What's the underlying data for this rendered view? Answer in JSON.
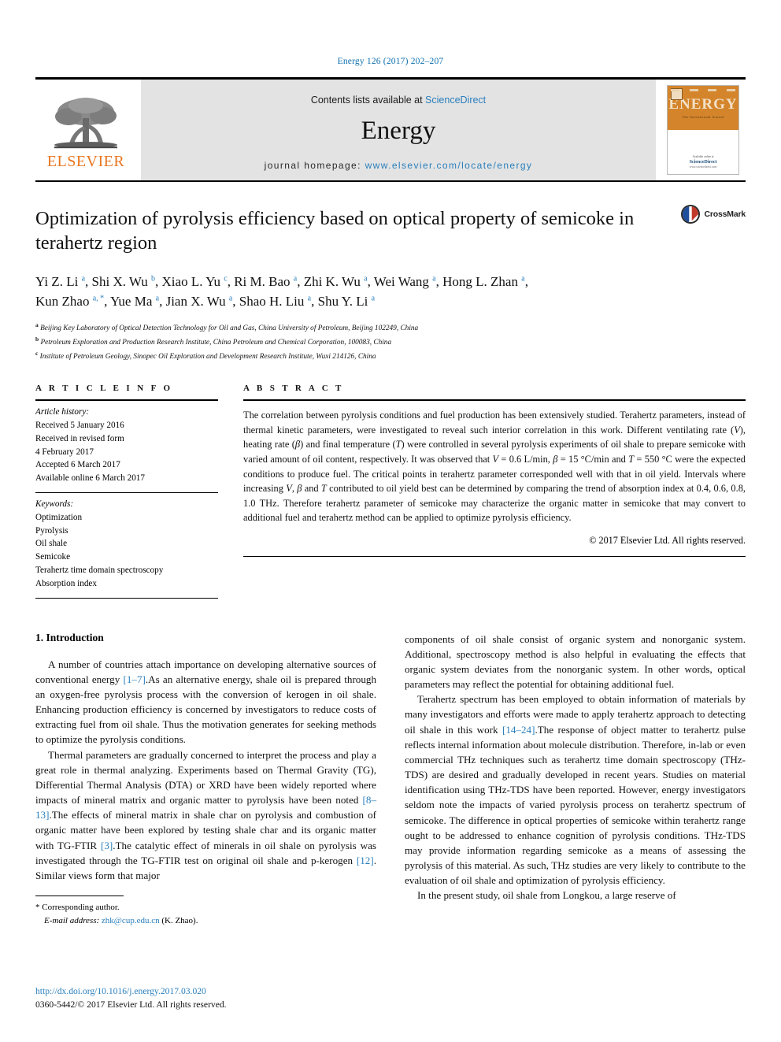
{
  "running_head": "Energy 126 (2017) 202–207",
  "masthead": {
    "publisher_name": "ELSEVIER",
    "contents_prefix": "Contents lists available at ",
    "contents_link": "ScienceDirect",
    "journal_title": "Energy",
    "homepage_prefix": "journal homepage: ",
    "homepage_url": "www.elsevier.com/locate/energy",
    "cover": {
      "title": "ENERGY",
      "subtitle": "The International Journal",
      "available_at": "Available online at",
      "sciencedirect": "ScienceDirect",
      "sd_url": "www.sciencedirect.com"
    }
  },
  "article": {
    "title": "Optimization of pyrolysis efficiency based on optical property of semicoke in terahertz region",
    "crossmark_label": "CrossMark",
    "authors_line_1": "Yi Z. Li ᵃ, Shi X. Wu ᵇ, Xiao L. Yu ᶜ, Ri M. Bao ᵃ, Zhi K. Wu ᵃ, Wei Wang ᵃ, Hong L. Zhan ᵃ,",
    "authors_line_2": "Kun Zhao ᵃ·*, Yue Ma ᵃ, Jian X. Wu ᵃ, Shao H. Liu ᵃ, Shu Y. Li ᵃ",
    "authors": [
      {
        "name": "Yi Z. Li",
        "sup": "a"
      },
      {
        "name": "Shi X. Wu",
        "sup": "b"
      },
      {
        "name": "Xiao L. Yu",
        "sup": "c"
      },
      {
        "name": "Ri M. Bao",
        "sup": "a"
      },
      {
        "name": "Zhi K. Wu",
        "sup": "a"
      },
      {
        "name": "Wei Wang",
        "sup": "a"
      },
      {
        "name": "Hong L. Zhan",
        "sup": "a"
      },
      {
        "name": "Kun Zhao",
        "sup": "a, *"
      },
      {
        "name": "Yue Ma",
        "sup": "a"
      },
      {
        "name": "Jian X. Wu",
        "sup": "a"
      },
      {
        "name": "Shao H. Liu",
        "sup": "a"
      },
      {
        "name": "Shu Y. Li",
        "sup": "a"
      }
    ],
    "affiliations": [
      {
        "mark": "a",
        "text": "Beijing Key Laboratory of Optical Detection Technology for Oil and Gas, China University of Petroleum, Beijing 102249, China"
      },
      {
        "mark": "b",
        "text": "Petroleum Exploration and Production Research Institute, China Petroleum and Chemical Corporation, 100083, China"
      },
      {
        "mark": "c",
        "text": "Institute of Petroleum Geology, Sinopec Oil Exploration and Development Research Institute, Wuxi 214126, China"
      }
    ]
  },
  "article_info": {
    "label": "A R T I C L E   I N F O",
    "history_label": "Article history:",
    "history": [
      "Received 5 January 2016",
      "Received in revised form",
      "4 February 2017",
      "Accepted 6 March 2017",
      "Available online 6 March 2017"
    ],
    "keywords_label": "Keywords:",
    "keywords": [
      "Optimization",
      "Pyrolysis",
      "Oil shale",
      "Semicoke",
      "Terahertz time domain spectroscopy",
      "Absorption index"
    ]
  },
  "abstract": {
    "label": "A B S T R A C T",
    "text": "The correlation between pyrolysis conditions and fuel production has been extensively studied. Terahertz parameters, instead of thermal kinetic parameters, were investigated to reveal such interior correlation in this work. Different ventilating rate (V), heating rate (β) and final temperature (T) were controlled in several pyrolysis experiments of oil shale to prepare semicoke with varied amount of oil content, respectively. It was observed that V = 0.6 L/min, β = 15 °C/min and T = 550 °C were the expected conditions to produce fuel. The critical points in terahertz parameter corresponded well with that in oil yield. Intervals where increasing V, β and T contributed to oil yield best can be determined by comparing the trend of absorption index at 0.4, 0.6, 0.8, 1.0 THz. Therefore terahertz parameter of semicoke may characterize the organic matter in semicoke that may convert to additional fuel and terahertz method can be applied to optimize pyrolysis efficiency.",
    "copyright": "© 2017 Elsevier Ltd. All rights reserved."
  },
  "body": {
    "section_number_title": "1. Introduction",
    "left_paragraphs": [
      "A number of countries attach importance on developing alternative sources of conventional energy [1–7].As an alternative energy, shale oil is prepared through an oxygen-free pyrolysis process with the conversion of kerogen in oil shale. Enhancing production efficiency is concerned by investigators to reduce costs of extracting fuel from oil shale. Thus the motivation generates for seeking methods to optimize the pyrolysis conditions.",
      "Thermal parameters are gradually concerned to interpret the process and play a great role in thermal analyzing. Experiments based on Thermal Gravity (TG), Differential Thermal Analysis (DTA) or XRD have been widely reported where impacts of mineral matrix and organic matter to pyrolysis have been noted [8–13].The effects of mineral matrix in shale char on pyrolysis and combustion of organic matter have been explored by testing shale char and its organic matter with TG-FTIR [3].The catalytic effect of minerals in oil shale on pyrolysis was investigated through the TG-FTIR test on original oil shale and p-kerogen [12]. Similar views form that major"
    ],
    "right_paragraphs": [
      "components of oil shale consist of organic system and nonorganic system. Additional, spectroscopy method is also helpful in evaluating the effects that organic system deviates from the nonorganic system. In other words, optical parameters may reflect the potential for obtaining additional fuel.",
      "Terahertz spectrum has been employed to obtain information of materials by many investigators and efforts were made to apply terahertz approach to detecting oil shale in this work [14–24].The response of object matter to terahertz pulse reflects internal information about molecule distribution. Therefore, in-lab or even commercial THz techniques such as terahertz time domain spectroscopy (THz-TDS) are desired and gradually developed in recent years. Studies on material identification using THz-TDS have been reported. However, energy investigators seldom note the impacts of varied pyrolysis process on terahertz spectrum of semicoke. The difference in optical properties of semicoke within terahertz range ought to be addressed to enhance cognition of pyrolysis conditions. THz-TDS may provide information regarding semicoke as a means of assessing the pyrolysis of this material. As such, THz studies are very likely to contribute to the evaluation of oil shale and optimization of pyrolysis efficiency.",
      "In the present study, oil shale from Longkou, a large reserve of"
    ]
  },
  "footnote": {
    "star": "*",
    "corresponding": "Corresponding author.",
    "email_label": "E-mail address:",
    "email": "zhk@cup.edu.cn",
    "email_owner": "(K. Zhao)."
  },
  "footer": {
    "doi": "http://dx.doi.org/10.1016/j.energy.2017.03.020",
    "issn_line": "0360-5442/© 2017 Elsevier Ltd. All rights reserved."
  },
  "colors": {
    "link_blue": "#2a7fbd",
    "header_blue": "#0b6eae",
    "elsevier_orange": "#E87722",
    "masthead_grey": "#e3e3e3",
    "cover_orange": "#d4852c"
  }
}
